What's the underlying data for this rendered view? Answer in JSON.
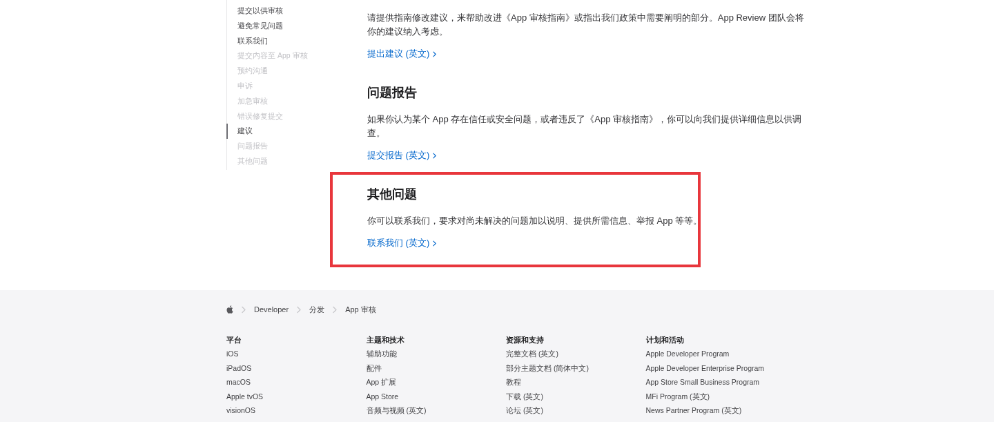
{
  "sidebar": {
    "items": [
      {
        "label": "提交以供审核",
        "dimmed": false,
        "selected": false
      },
      {
        "label": "避免常见问题",
        "dimmed": false,
        "selected": false
      },
      {
        "label": "联系我们",
        "dimmed": false,
        "selected": false
      },
      {
        "label": "提交内容至 App 审核",
        "dimmed": true,
        "selected": false
      },
      {
        "label": "预约沟通",
        "dimmed": true,
        "selected": false
      },
      {
        "label": "申诉",
        "dimmed": true,
        "selected": false
      },
      {
        "label": "加急审核",
        "dimmed": true,
        "selected": false
      },
      {
        "label": "错误修复提交",
        "dimmed": true,
        "selected": false
      },
      {
        "label": "建议",
        "dimmed": false,
        "selected": true
      },
      {
        "label": "问题报告",
        "dimmed": true,
        "selected": false
      },
      {
        "label": "其他问题",
        "dimmed": true,
        "selected": false
      }
    ]
  },
  "sections": [
    {
      "paragraph": "请提供指南修改建议，来帮助改进《App 审核指南》或指出我们政策中需要阐明的部分。App Review 团队会将你的建议纳入考虑。",
      "link": "提出建议 (英文)",
      "highlighted": false
    },
    {
      "heading": "问题报告",
      "paragraph": "如果你认为某个 App 存在信任或安全问题，或者违反了《App 审核指南》，你可以向我们提供详细信息以供调查。",
      "link": "提交报告 (英文)",
      "highlighted": false
    },
    {
      "heading": "其他问题",
      "paragraph": "你可以联系我们，要求对尚未解决的问题加以说明、提供所需信息、举报 App 等等。",
      "link": "联系我们 (英文)",
      "highlighted": true
    }
  ],
  "footer": {
    "breadcrumb": [
      {
        "label": "Developer"
      },
      {
        "label": "分发"
      },
      {
        "label": "App 审核"
      }
    ],
    "columns": [
      {
        "title": "平台",
        "links": [
          "iOS",
          "iPadOS",
          "macOS",
          "Apple tvOS",
          "visionOS"
        ]
      },
      {
        "title": "主题和技术",
        "links": [
          "辅助功能",
          "配件",
          "App 扩展",
          "App Store",
          "音频与视频 (英文)"
        ]
      },
      {
        "title": "资源和支持",
        "links": [
          "完整文档 (英文)",
          "部分主题文档 (简体中文)",
          "教程",
          "下载 (英文)",
          "论坛 (英文)"
        ]
      },
      {
        "title": "计划和活动",
        "links": [
          "Apple Developer Program",
          "Apple Developer Enterprise Program",
          "App Store Small Business Program",
          "MFi Program (英文)",
          "News Partner Program (英文)"
        ]
      }
    ]
  }
}
